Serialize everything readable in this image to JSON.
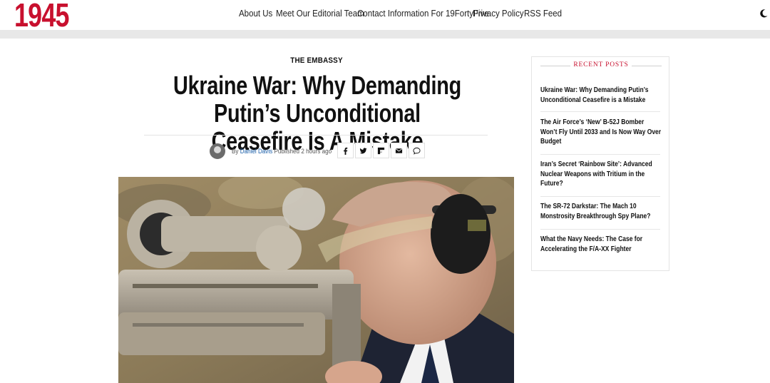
{
  "site": {
    "logo": "1945",
    "nav": [
      "About Us",
      "Meet Our Editorial Team",
      "Contact Information For 19FortyFive",
      "Privacy Policy",
      "RSS Feed"
    ],
    "theme_icon": "moon-icon"
  },
  "article": {
    "category": "THE EMBASSY",
    "headline": "Ukraine War: Why Demanding Putin’s Unconditional Ceasefire Is A Mistake",
    "byline": {
      "by": "By",
      "author": "Daniel Davis",
      "published": "Published",
      "time": "2 hours ago"
    },
    "share_icons": [
      "facebook-icon",
      "twitter-icon",
      "flipboard-icon",
      "email-icon",
      "comment-icon"
    ],
    "image_alt": ""
  },
  "sidebar": {
    "title": "RECENT POSTS",
    "posts": [
      "Ukraine War: Why Demanding Putin’s Unconditional Ceasefire is a Mistake",
      "The Air Force’s ‘New’ B-52J Bomber Won’t Fly Until 2033 and Is Now Way Over Budget",
      "Iran’s Secret ‘Rainbow Site’: Advanced Nuclear Weapons with Tritium in the Future?",
      "The SR-72 Darkstar: The Mach 10 Monstrosity Breakthrough Spy Plane?",
      "What the Navy Needs: The Case for Accelerating the F/A-XX Fighter"
    ]
  },
  "colors": {
    "brand": "#c8102e",
    "link": "#1a5ea8"
  }
}
